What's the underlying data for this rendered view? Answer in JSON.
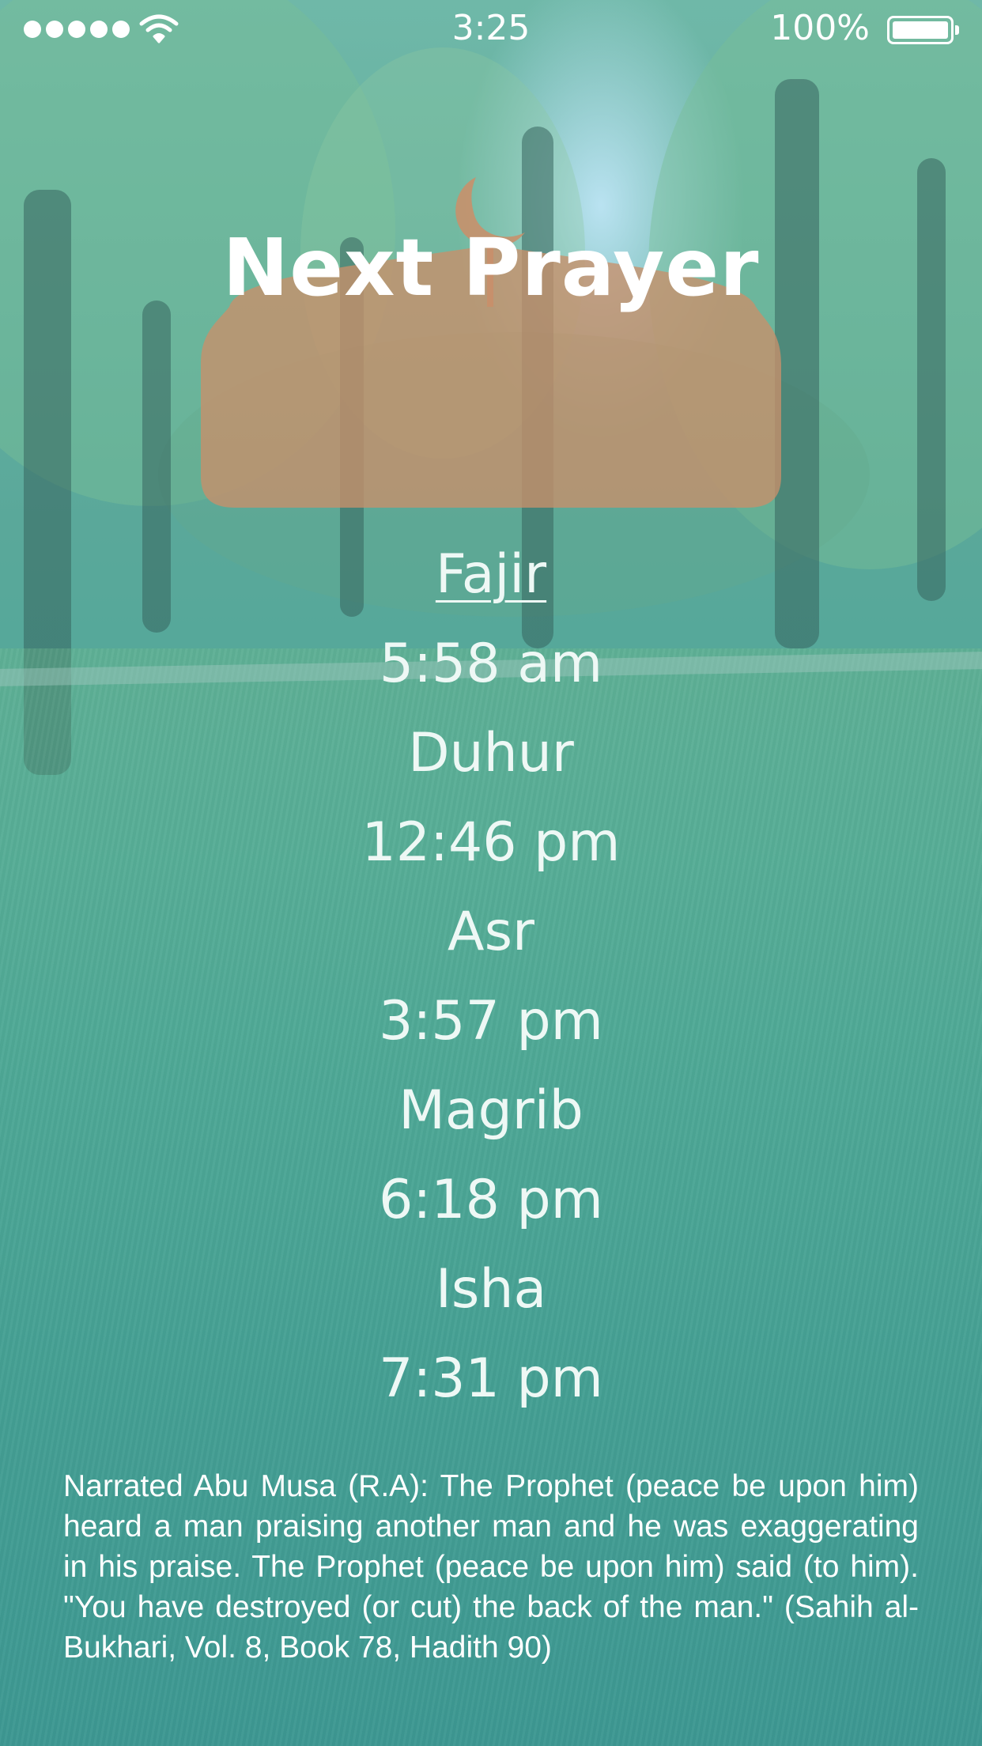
{
  "status_bar": {
    "time": "3:25",
    "battery_percent": "100%",
    "signal_bars": 5,
    "battery_level": 1.0
  },
  "header": {
    "title": "Next Prayer"
  },
  "prayers": [
    {
      "name": "Fajir",
      "time": "5:58 am",
      "next": true
    },
    {
      "name": "Duhur",
      "time": "12:46 pm",
      "next": false
    },
    {
      "name": "Asr",
      "time": "3:57 pm",
      "next": false
    },
    {
      "name": "Magrib",
      "time": "6:18 pm",
      "next": false
    },
    {
      "name": "Isha",
      "time": "7:31 pm",
      "next": false
    }
  ],
  "hadith": {
    "text": "Narrated Abu Musa (R.A): The Prophet (peace be upon him) heard a man praising another man and he was exaggerating in his praise. The Prophet (peace be upon him) said (to him). \"You have destroyed (or cut) the back of the man.\" (Sahih al-Bukhari, Vol. 8, Book 78, Hadith 90)"
  },
  "colors": {
    "overlay_teal": "#46a39a",
    "dome_orange": "#c98f6a",
    "text": "#ffffff"
  },
  "icons": [
    "signal-dots-icon",
    "wifi-icon",
    "battery-icon",
    "crescent-moon-icon",
    "mosque-dome-icon"
  ]
}
